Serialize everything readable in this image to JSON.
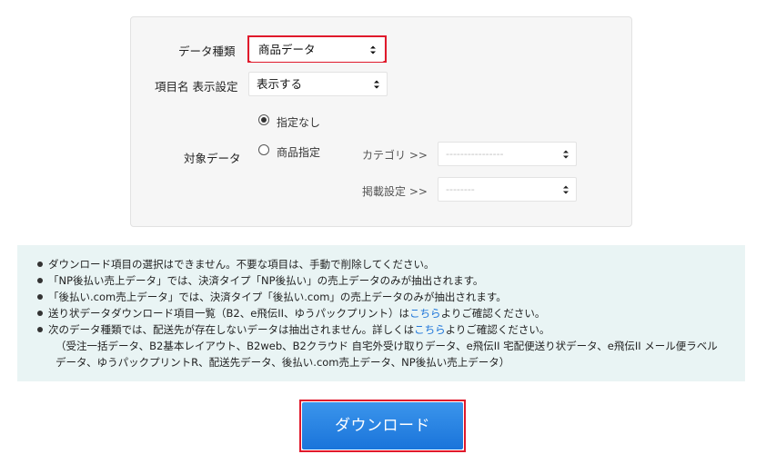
{
  "form": {
    "data_type_label": "データ種類",
    "data_type_value": "商品データ",
    "item_name_label": "項目名 表示設定",
    "item_name_value": "表示する",
    "target_label": "対象データ",
    "radio_none_label": "指定なし",
    "radio_product_label": "商品指定",
    "category_label": "カテゴリ >>",
    "category_value": "----------------",
    "listing_label": "掲載設定 >>",
    "listing_value": "--------"
  },
  "notes": {
    "line1": "ダウンロード項目の選択はできません。不要な項目は、手動で削除してください。",
    "line2": "「NP後払い売上データ」では、決済タイプ「NP後払い」の売上データのみが抽出されます。",
    "line3": "「後払い.com売上データ」では、決済タイプ「後払い.com」の売上データのみが抽出されます。",
    "line4_pre": "送り状データダウンロード項目一覧（B2、e飛伝II、ゆうパックプリント）は",
    "line4_link": "こちら",
    "line4_post": "よりご確認ください。",
    "line5_pre": "次のデータ種類では、配送先が存在しないデータは抽出されません。詳しくは",
    "line5_link": "こちら",
    "line5_post": "よりご確認ください。",
    "line6": "（受注一括データ、B2基本レイアウト、B2web、B2クラウド 自宅外受け取りデータ、e飛伝II 宅配便送り状データ、e飛伝II メール便ラベルデータ、ゆうパックプリントR、配送先データ、後払い.com売上データ、NP後払い売上データ）"
  },
  "download_label": "ダウンロード",
  "colors": {
    "highlight": "#e0192b",
    "button": "#1f7ee0",
    "link": "#1a73d9",
    "notes_bg": "#e9f4f4"
  }
}
